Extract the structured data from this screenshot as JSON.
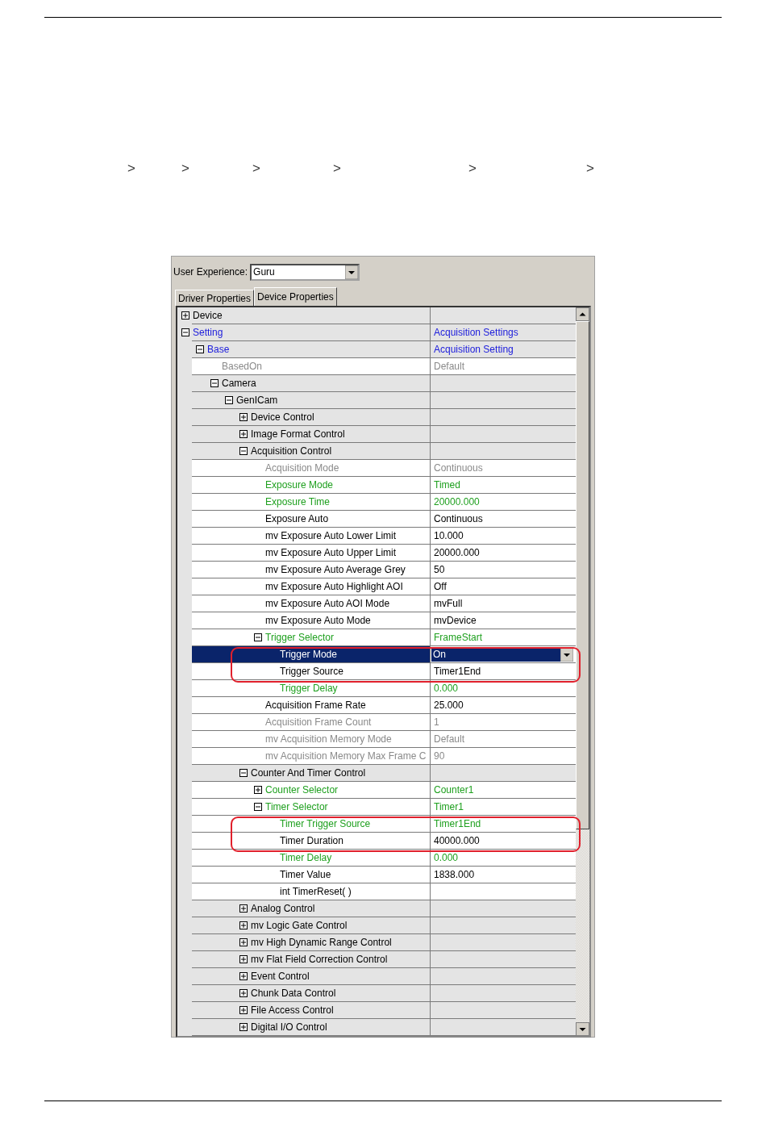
{
  "breadcrumb_separators": [
    ">",
    ">",
    ">",
    ">",
    ">",
    ">"
  ],
  "panel": {
    "user_experience": {
      "label": "User Experience:",
      "value": "Guru"
    },
    "tabs": [
      {
        "label": "Driver Properties",
        "selected": false
      },
      {
        "label": "Device Properties",
        "selected": true
      }
    ],
    "tree": [
      {
        "name": "Device",
        "kind": "category",
        "color": "#000000",
        "selected": false,
        "expanded": false
      },
      {
        "name": "Setting",
        "value": "Acquisition Settings",
        "kind": "category",
        "color": "#1a1adc",
        "selected": false,
        "expanded": true,
        "children": [
          {
            "name": "Base",
            "value": "Acquisition Setting",
            "kind": "category",
            "color": "#1a1adc",
            "selected": false,
            "expanded": true,
            "children": [
              {
                "name": "BasedOn",
                "value": "Default",
                "kind": "property",
                "color": "#8a8a8a",
                "selected": false
              },
              {
                "name": "Camera",
                "kind": "category",
                "color": "#000000",
                "selected": false,
                "expanded": true,
                "children": [
                  {
                    "name": "GenICam",
                    "kind": "category",
                    "color": "#000000",
                    "selected": false,
                    "expanded": true,
                    "children": [
                      {
                        "name": "Device Control",
                        "kind": "category",
                        "color": "#000000",
                        "selected": false,
                        "expanded": false
                      },
                      {
                        "name": "Image Format Control",
                        "kind": "category",
                        "color": "#000000",
                        "selected": false,
                        "expanded": false
                      },
                      {
                        "name": "Acquisition Control",
                        "kind": "category",
                        "color": "#000000",
                        "selected": false,
                        "expanded": true,
                        "children": [
                          {
                            "name": "Acquisition Mode",
                            "value": "Continuous",
                            "kind": "property",
                            "color": "#8a8a8a",
                            "selected": false
                          },
                          {
                            "name": "Exposure Mode",
                            "value": "Timed",
                            "kind": "property",
                            "color": "#1fa01f",
                            "selected": false
                          },
                          {
                            "name": "Exposure Time",
                            "value": "20000.000",
                            "kind": "property",
                            "color": "#1fa01f",
                            "selected": false
                          },
                          {
                            "name": "Exposure Auto",
                            "value": "Continuous",
                            "kind": "property",
                            "color": "#000000",
                            "selected": false
                          },
                          {
                            "name": "mv Exposure Auto Lower Limit",
                            "value": "10.000",
                            "kind": "property",
                            "color": "#000000",
                            "selected": false
                          },
                          {
                            "name": "mv Exposure Auto Upper Limit",
                            "value": "20000.000",
                            "kind": "property",
                            "color": "#000000",
                            "selected": false
                          },
                          {
                            "name": "mv Exposure Auto Average Grey",
                            "value": "50",
                            "kind": "property",
                            "color": "#000000",
                            "selected": false
                          },
                          {
                            "name": "mv Exposure Auto Highlight AOI",
                            "value": "Off",
                            "kind": "property",
                            "color": "#000000",
                            "selected": false
                          },
                          {
                            "name": "mv Exposure Auto AOI Mode",
                            "value": "mvFull",
                            "kind": "property",
                            "color": "#000000",
                            "selected": false
                          },
                          {
                            "name": "mv Exposure Auto Mode",
                            "value": "mvDevice",
                            "kind": "property",
                            "color": "#000000",
                            "selected": false
                          },
                          {
                            "name": "Trigger Selector",
                            "value": "FrameStart",
                            "kind": "property",
                            "color": "#1fa01f",
                            "selected": false,
                            "expanded": true,
                            "children": [
                              {
                                "name": "Trigger Mode",
                                "value": "On",
                                "kind": "property",
                                "color": "#ffffff",
                                "selected": true,
                                "outlined": true
                              },
                              {
                                "name": "Trigger Source",
                                "value": "Timer1End",
                                "kind": "property",
                                "color": "#000000",
                                "selected": false,
                                "outlined": true
                              },
                              {
                                "name": "Trigger Delay",
                                "value": "0.000",
                                "kind": "property",
                                "color": "#1fa01f",
                                "selected": false
                              }
                            ]
                          },
                          {
                            "name": "Acquisition Frame Rate",
                            "value": "25.000",
                            "kind": "property",
                            "color": "#000000",
                            "selected": false
                          },
                          {
                            "name": "Acquisition Frame Count",
                            "value": "1",
                            "kind": "property",
                            "color": "#8a8a8a",
                            "selected": false
                          },
                          {
                            "name": "mv Acquisition Memory Mode",
                            "value": "Default",
                            "kind": "property",
                            "color": "#8a8a8a",
                            "selected": false
                          },
                          {
                            "name": "mv Acquisition Memory Max Frame C",
                            "value": "90",
                            "kind": "property",
                            "color": "#8a8a8a",
                            "selected": false
                          }
                        ]
                      },
                      {
                        "name": "Counter And Timer Control",
                        "kind": "category",
                        "color": "#000000",
                        "selected": false,
                        "expanded": true,
                        "children": [
                          {
                            "name": "Counter Selector",
                            "value": "Counter1",
                            "kind": "property",
                            "color": "#1fa01f",
                            "selected": false,
                            "expanded": false
                          },
                          {
                            "name": "Timer Selector",
                            "value": "Timer1",
                            "kind": "property",
                            "color": "#1fa01f",
                            "selected": false,
                            "expanded": true,
                            "children": [
                              {
                                "name": "Timer Trigger Source",
                                "value": "Timer1End",
                                "kind": "property",
                                "color": "#1fa01f",
                                "selected": false,
                                "outlined": true
                              },
                              {
                                "name": "Timer Duration",
                                "value": "40000.000",
                                "kind": "property",
                                "color": "#000000",
                                "selected": false,
                                "outlined": true
                              },
                              {
                                "name": "Timer Delay",
                                "value": "0.000",
                                "kind": "property",
                                "color": "#1fa01f",
                                "selected": false
                              },
                              {
                                "name": "Timer Value",
                                "value": "1838.000",
                                "kind": "property",
                                "color": "#000000",
                                "selected": false
                              },
                              {
                                "name": "int TimerReset( )",
                                "kind": "property",
                                "color": "#000000",
                                "selected": false
                              }
                            ]
                          }
                        ]
                      },
                      {
                        "name": "Analog Control",
                        "kind": "category",
                        "color": "#000000",
                        "selected": false,
                        "expanded": false
                      },
                      {
                        "name": "mv Logic Gate Control",
                        "kind": "category",
                        "color": "#000000",
                        "selected": false,
                        "expanded": false
                      },
                      {
                        "name": "mv High Dynamic Range Control",
                        "kind": "category",
                        "color": "#000000",
                        "selected": false,
                        "expanded": false
                      },
                      {
                        "name": "mv Flat Field Correction Control",
                        "kind": "category",
                        "color": "#000000",
                        "selected": false,
                        "expanded": false
                      },
                      {
                        "name": "Event Control",
                        "kind": "category",
                        "color": "#000000",
                        "selected": false,
                        "expanded": false
                      },
                      {
                        "name": "Chunk Data Control",
                        "kind": "category",
                        "color": "#000000",
                        "selected": false,
                        "expanded": false
                      },
                      {
                        "name": "File Access Control",
                        "kind": "category",
                        "color": "#000000",
                        "selected": false,
                        "expanded": false
                      },
                      {
                        "name": "Digital I/O Control",
                        "kind": "category",
                        "color": "#000000",
                        "selected": false,
                        "expanded": false
                      }
                    ]
                  }
                ]
              }
            ]
          }
        ]
      }
    ]
  }
}
